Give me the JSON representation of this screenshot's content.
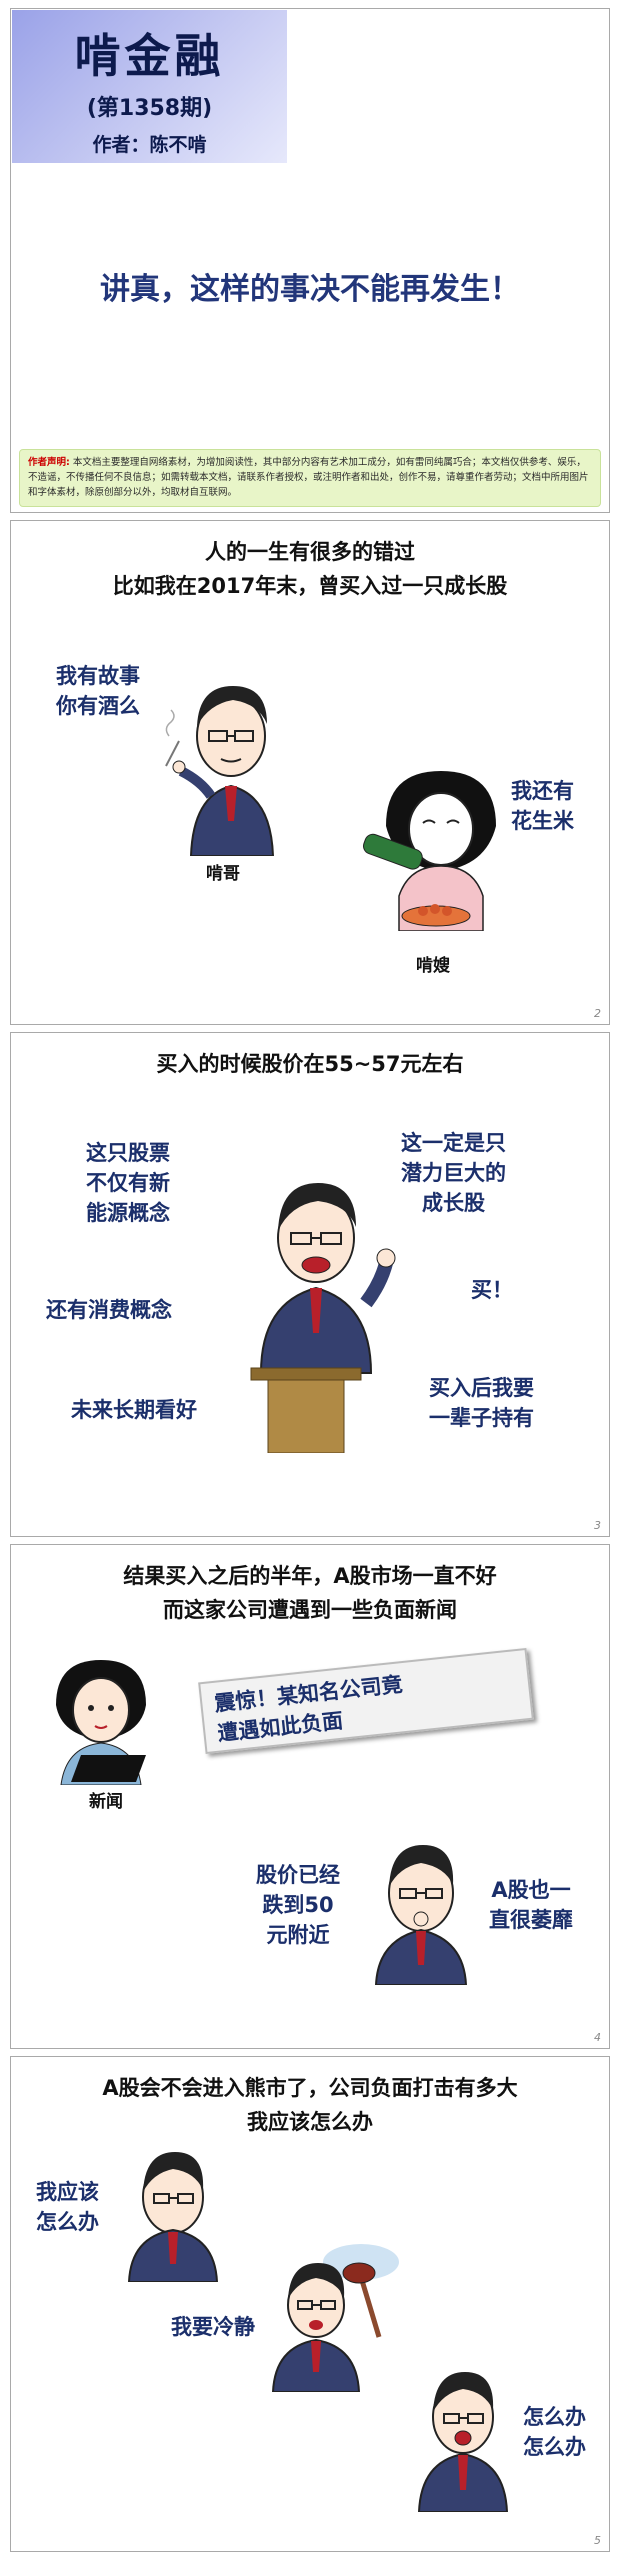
{
  "panel1": {
    "brand": "啃金融",
    "issue": "(第1358期)",
    "author": "作者：陈不啃",
    "headline": "讲真，这样的事决不能再发生！",
    "disclaimer_label": "作者声明:",
    "disclaimer_text": "本文档主要整理自网络素材，为增加阅读性，其中部分内容有艺术加工成分，如有雷同纯属巧合；本文档仅供参考、娱乐，不造谣，不传播任何不良信息；如需转载本文档，请联系作者授权，或注明作者和出处，创作不易，请尊重作者劳动；文档中所用图片和字体素材，除原创部分以外，均取材自互联网。"
  },
  "panel2": {
    "title_line1": "人的一生有很多的错过",
    "title_line2": "比如我在2017年末，曾买入过一只成长股",
    "say_left_1": "我有故事",
    "say_left_2": "你有酒么",
    "name_left": "啃哥",
    "say_right_1": "我还有",
    "say_right_2": "花生米",
    "name_right": "啃嫂",
    "page": "2"
  },
  "panel3": {
    "title": "买入的时候股价在55~57元左右",
    "say1_1": "这只股票",
    "say1_2": "不仅有新",
    "say1_3": "能源概念",
    "say2": "还有消费概念",
    "say3": "未来长期看好",
    "say4_1": "这一定是只",
    "say4_2": "潜力巨大的",
    "say4_3": "成长股",
    "say5": "买！",
    "say6_1": "买入后我要",
    "say6_2": "一辈子持有",
    "page": "3"
  },
  "panel4": {
    "title_line1": "结果买入之后的半年，A股市场一直不好",
    "title_line2": "而这家公司遭遇到一些负面新闻",
    "news_line1": "震惊！某知名公司竟",
    "news_line2": "遭遇如此负面",
    "name_news": "新闻",
    "say_left_1": "股价已经",
    "say_left_2": "跌到50",
    "say_left_3": "元附近",
    "say_right_1": "A股也一",
    "say_right_2": "直很萎靡",
    "page": "4"
  },
  "panel5": {
    "title_line1": "A股会不会进入熊市了，公司负面打击有多大",
    "title_line2": "我应该怎么办",
    "say1_1": "我应该",
    "say1_2": "怎么办",
    "say2": "我要冷静",
    "say3_1": "怎么办",
    "say3_2": "怎么办",
    "page": "5"
  }
}
